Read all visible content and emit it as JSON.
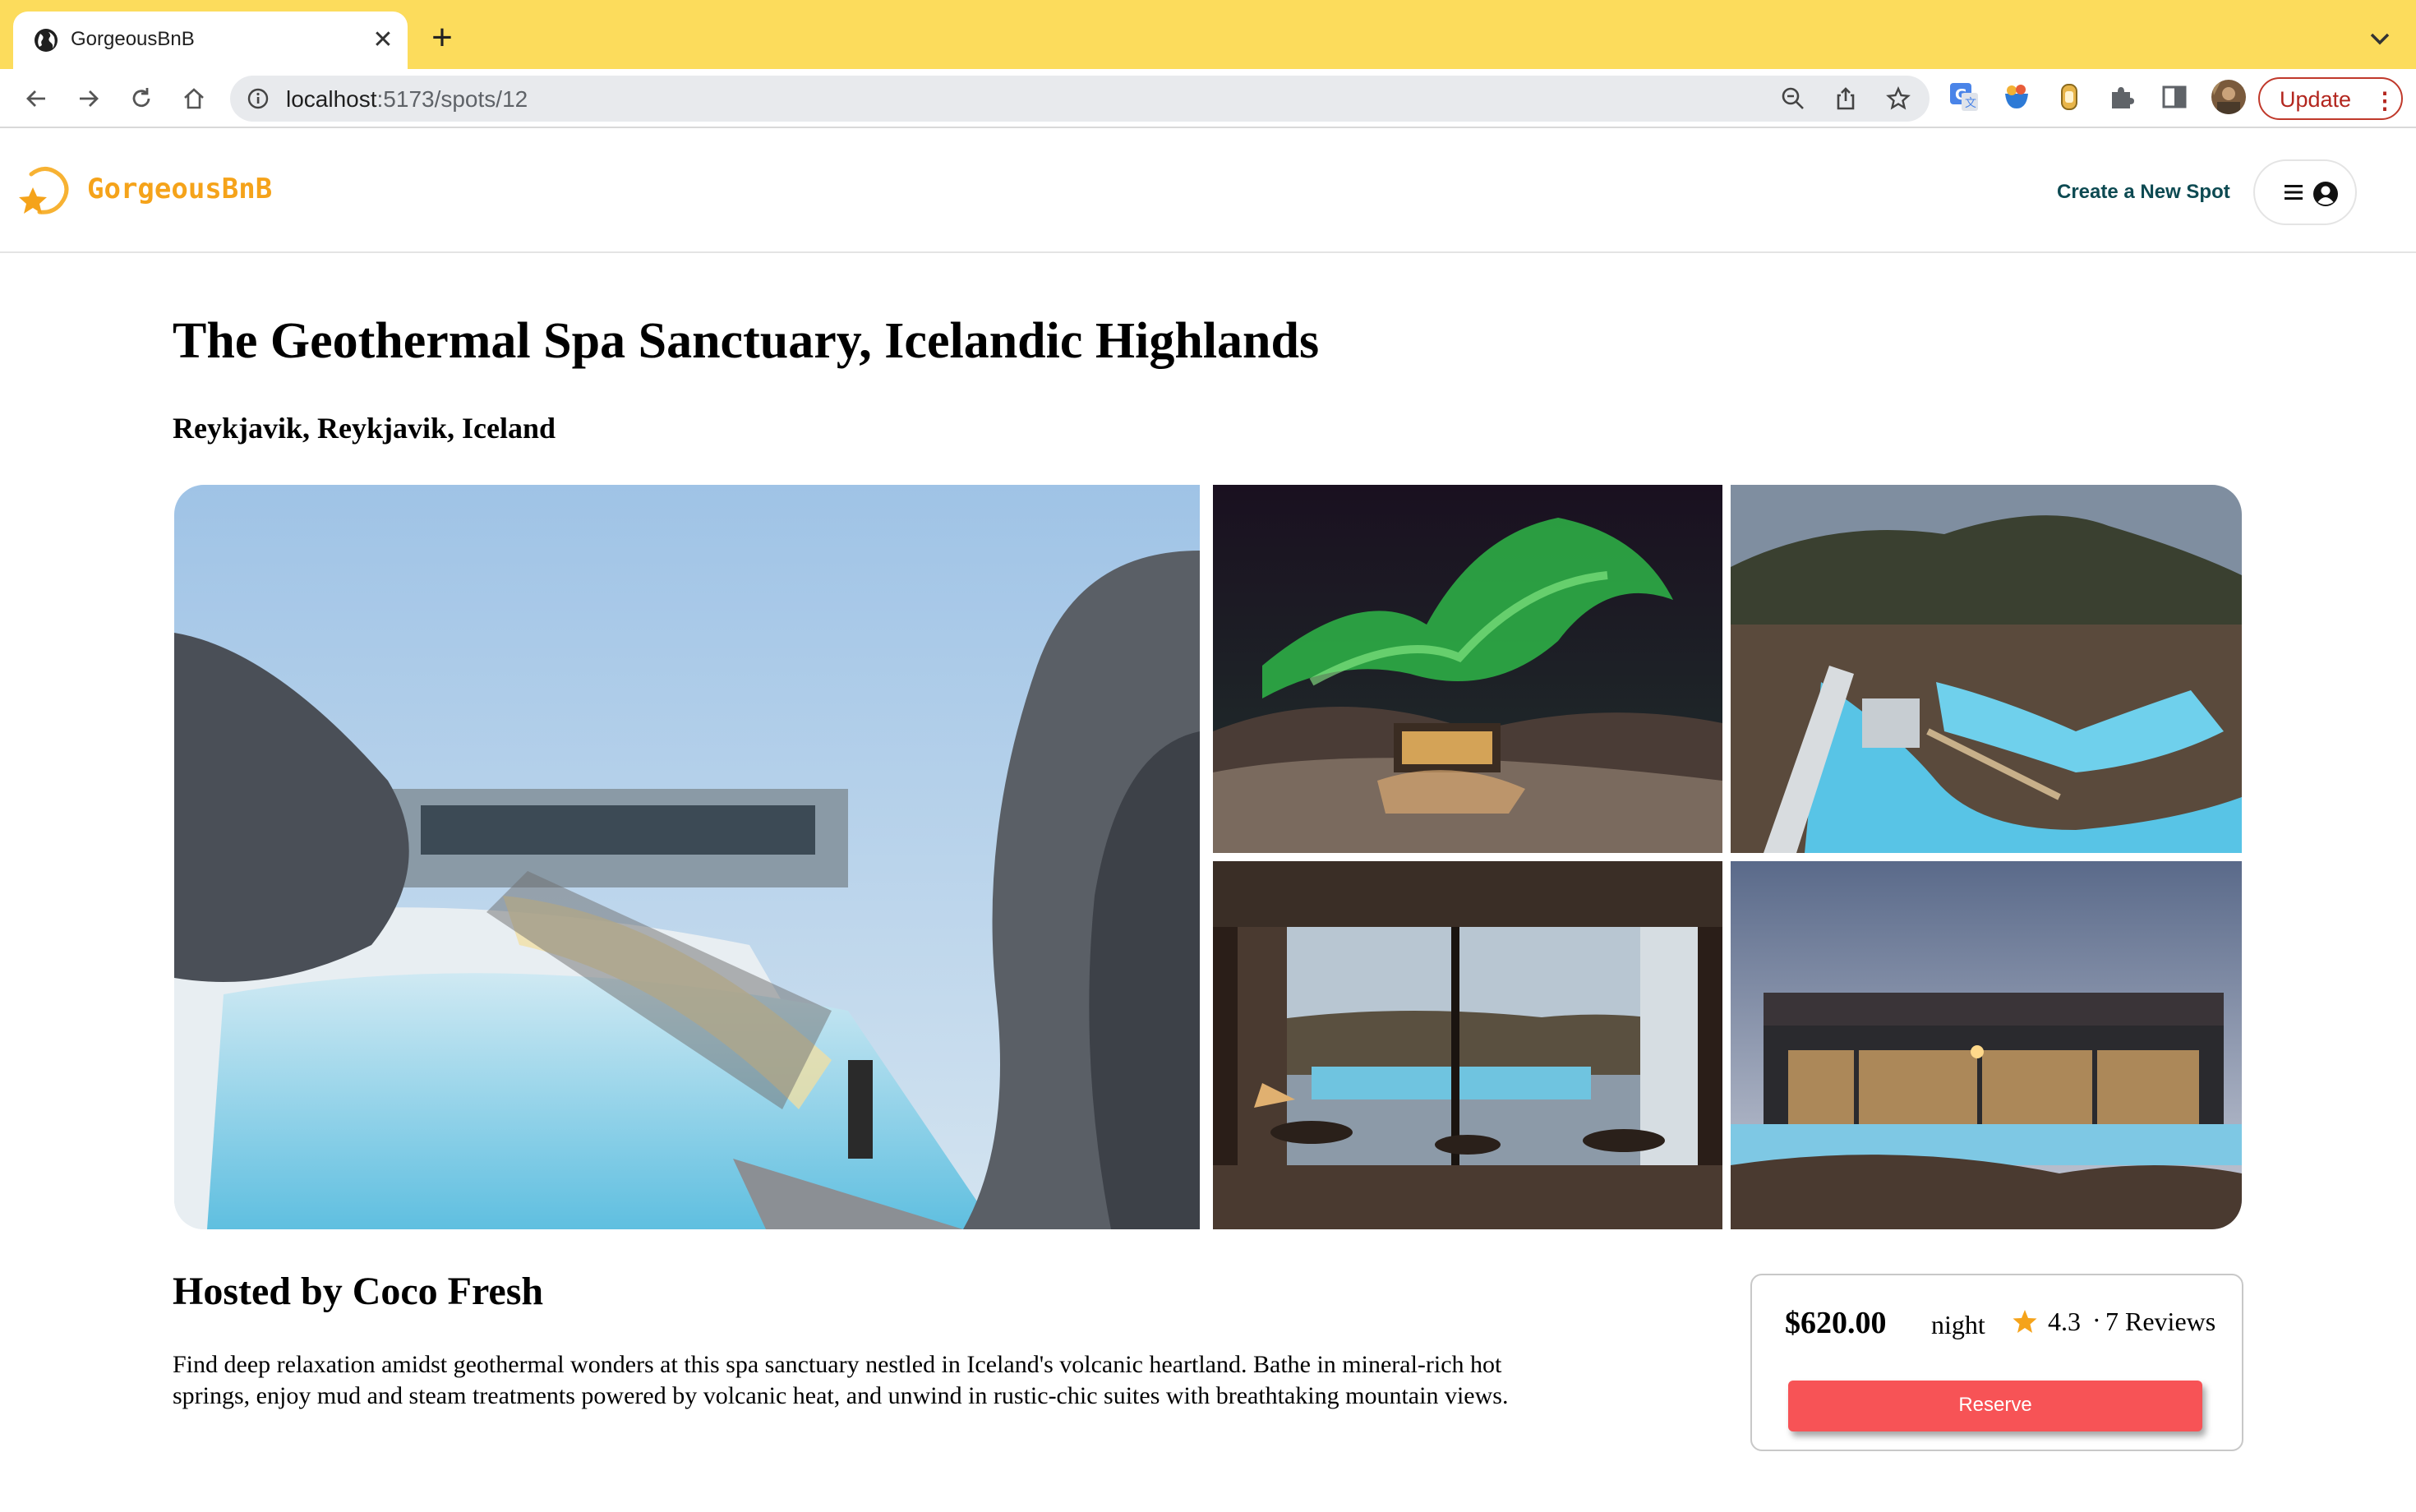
{
  "browser": {
    "tab_title": "GorgeousBnB",
    "url_host": "localhost",
    "url_path": ":5173/spots/12",
    "update_label": "Update"
  },
  "header": {
    "brand": "GorgeousBnB",
    "create_link": "Create a New Spot"
  },
  "spot": {
    "title": "The Geothermal Spa Sanctuary, Icelandic Highlands",
    "location": "Reykjavik, Reykjavik, Iceland",
    "host": "Hosted by Coco Fresh",
    "description": "Find deep relaxation amidst geothermal wonders at this spa sanctuary nestled in Iceland's volcanic heartland. Bathe in mineral-rich hot springs, enjoy mud and steam treatments powered by volcanic heat, and unwind in rustic-chic suites with breathtaking mountain views."
  },
  "booking": {
    "price": "$620.00",
    "per": "night",
    "rating": "4.3",
    "separator": "·",
    "reviews": "7 Reviews",
    "reserve_label": "Reserve"
  },
  "colors": {
    "tabstrip": "#fcdc5c",
    "brand": "#f5a31a",
    "link": "#0d4a52",
    "reserve": "#f75356"
  },
  "icons": [
    "globe-icon",
    "close-icon",
    "plus-icon",
    "back-icon",
    "forward-icon",
    "reload-icon",
    "home-icon",
    "info-icon",
    "zoom-icon",
    "share-icon",
    "bookmark-star-icon",
    "puzzle-icon",
    "sidepanel-icon",
    "hamburger-icon",
    "user-icon",
    "star-icon",
    "logo-star-icon"
  ]
}
